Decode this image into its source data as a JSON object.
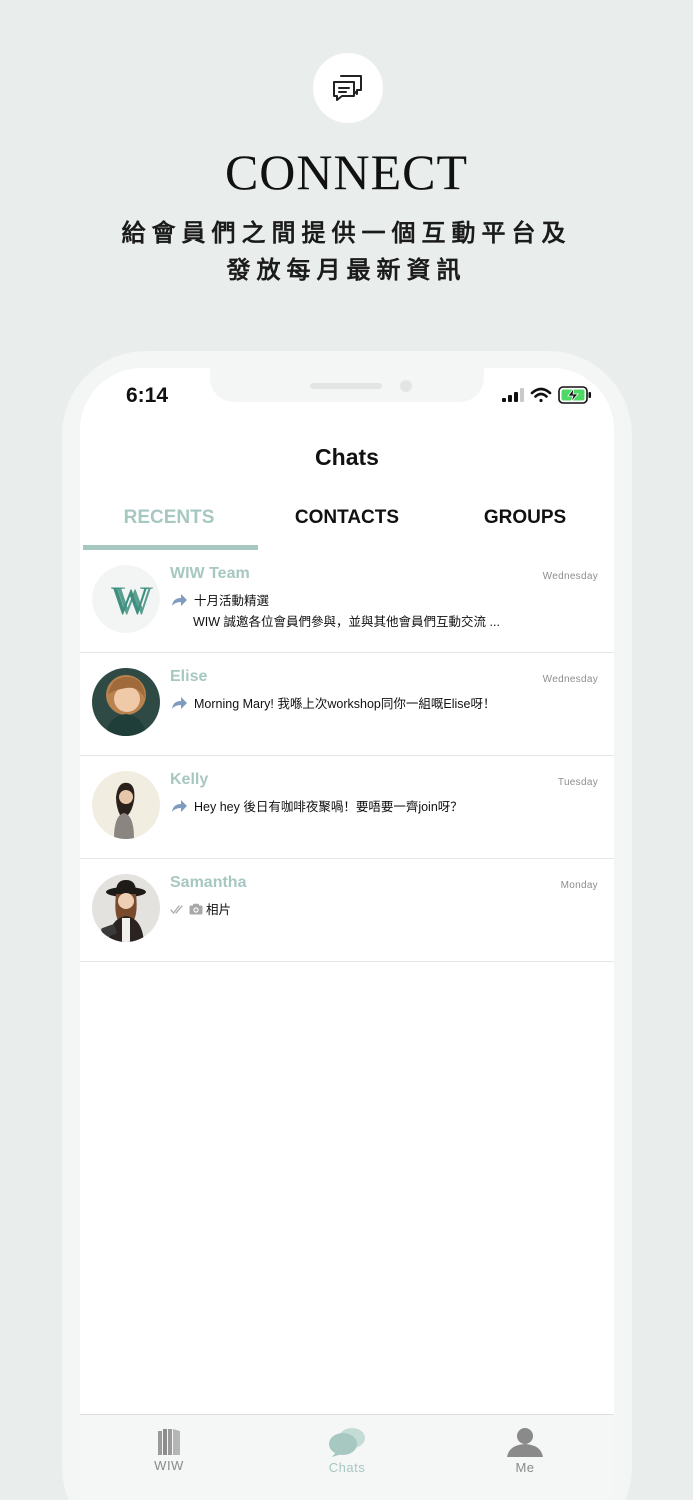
{
  "hero": {
    "icon": "chat-bubbles-icon",
    "title": "CONNECT",
    "subtitle_line1": "給會員們之間提供一個互動平台及",
    "subtitle_line2": "發放每月最新資訊"
  },
  "status_bar": {
    "time": "6:14",
    "icons": [
      "cellular-signal-icon",
      "wifi-icon",
      "battery-charging-icon"
    ]
  },
  "header": {
    "title": "Chats"
  },
  "tabs": [
    {
      "label": "RECENTS",
      "active": true
    },
    {
      "label": "CONTACTS",
      "active": false
    },
    {
      "label": "GROUPS",
      "active": false
    }
  ],
  "chats": [
    {
      "name": "WIW Team",
      "date": "Wednesday",
      "line1": "十月活動精選",
      "line2": "WIW 誠邀各位會員們參與，並與其他會員們互動交流 ...",
      "status_icon": "forward-arrow-icon"
    },
    {
      "name": "Elise",
      "date": "Wednesday",
      "line1": "Morning Mary! 我喺上次workshop同你一組嘅Elise呀！",
      "status_icon": "forward-arrow-icon"
    },
    {
      "name": "Kelly",
      "date": "Tuesday",
      "line1": "Hey hey 後日有咖啡夜聚喎！要唔要一齊join呀？",
      "status_icon": "forward-arrow-icon"
    },
    {
      "name": "Samantha",
      "date": "Monday",
      "line1": "相片",
      "status_icon": "double-check-icon"
    }
  ],
  "tabbar": [
    {
      "label": "WIW",
      "icon": "building-icon",
      "active": false
    },
    {
      "label": "Chats",
      "icon": "chat-bubbles-icon",
      "active": true
    },
    {
      "label": "Me",
      "icon": "person-icon",
      "active": false
    }
  ],
  "colors": {
    "accent": "#a7c7c1",
    "background": "#e9eeed",
    "wiw_green": "#3f8f7f"
  }
}
